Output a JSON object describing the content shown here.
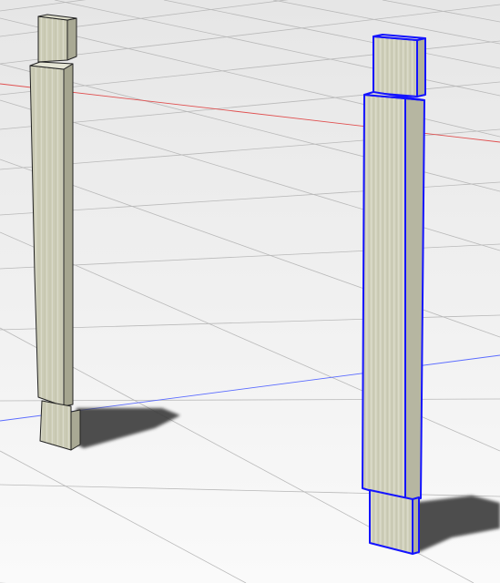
{
  "viewport": {
    "background_top": "#e6e6e6",
    "background_bottom": "#fafafa",
    "grid_color": "#b9b9b9",
    "x_axis_color": "#e05050",
    "y_axis_color": "#5a6bff"
  },
  "objects": [
    {
      "name": "left-post",
      "selected": false,
      "wood_light": "#dcdcc8",
      "wood_mid": "#c9c9b3",
      "wood_dark": "#a9a994",
      "edge_color": "#222222"
    },
    {
      "name": "right-post",
      "selected": true,
      "wood_light": "#dedecb",
      "wood_mid": "#cacab5",
      "wood_dark": "#b0b09b",
      "edge_color": "#1414ff"
    }
  ],
  "shadow_color": "#3a3a3a"
}
